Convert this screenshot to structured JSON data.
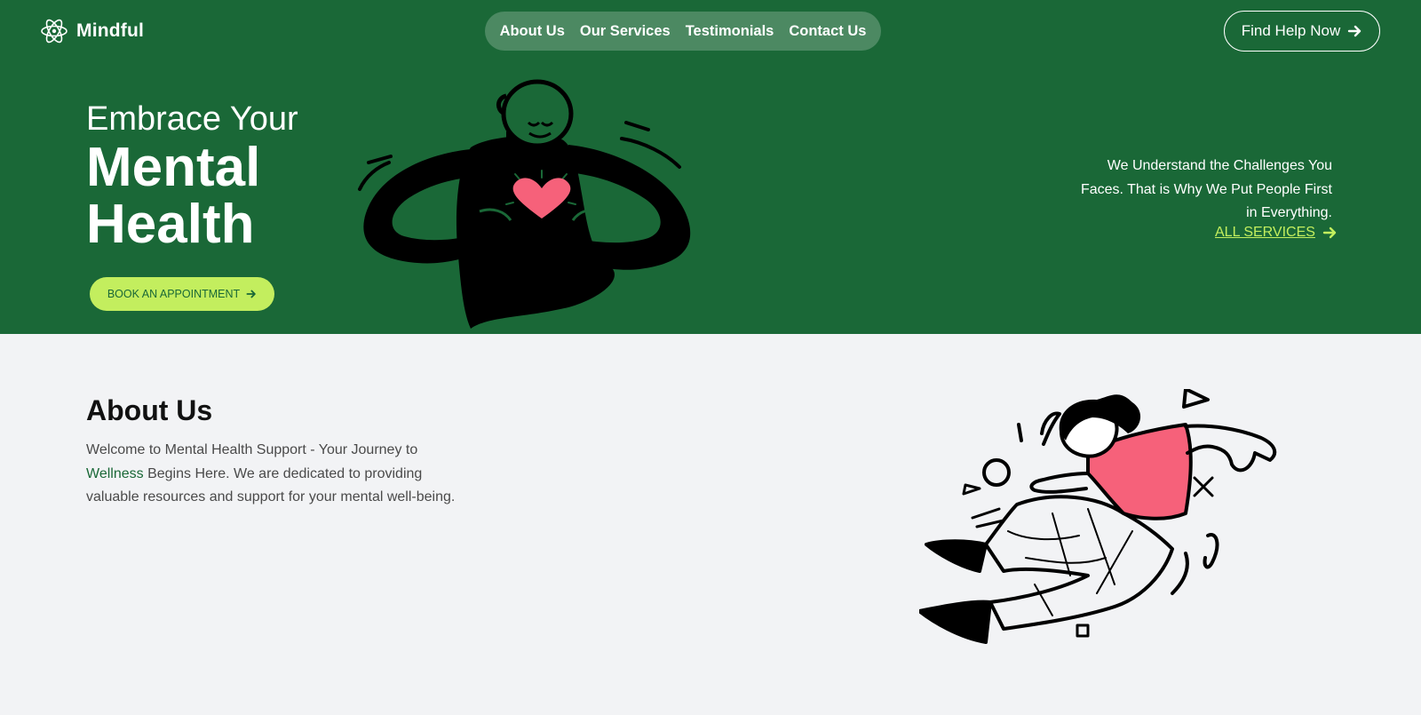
{
  "header": {
    "brand": "Mindful",
    "logo_icon": "atom-icon",
    "nav": [
      "About Us",
      "Our Services",
      "Testimonials",
      "Contact Us"
    ],
    "cta_label": "Find Help Now"
  },
  "hero": {
    "line1": "Embrace Your",
    "line2": "Mental",
    "line3": "Health",
    "book_button_label": "BOOK AN APPOINTMENT",
    "illustration": "person-holding-heart",
    "tagline": [
      "We Understand the Challenges You",
      "Faces. That is Why We Put People First",
      "in Everything."
    ],
    "services_link": "ALL SERVICES"
  },
  "about": {
    "title": "About Us",
    "text_before": "Welcome to Mental Health Support - Your Journey to ",
    "text_accent": "Wellness",
    "text_after": " Begins Here. We are dedicated to providing valuable resources and support for your mental well-being.",
    "illustration": "person-flying"
  },
  "colors": {
    "primary": "#1a6837",
    "accent": "#c3ee5e",
    "background": "#f2f3f5",
    "heart": "#f6617a"
  }
}
